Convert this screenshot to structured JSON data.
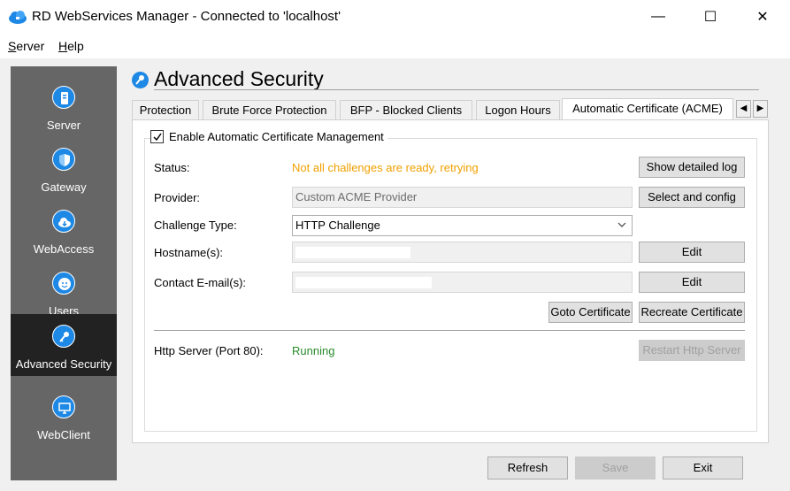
{
  "window": {
    "title": "RD WebServices Manager - Connected to 'localhost'",
    "minimize": "—",
    "maximize": "☐",
    "close": "✕"
  },
  "menu": {
    "server_first": "S",
    "server_rest": "erver",
    "help_first": "H",
    "help_rest": "elp"
  },
  "sidebar": {
    "items": [
      {
        "label": "Server",
        "icon": "server-icon",
        "active": false
      },
      {
        "label": "Gateway",
        "icon": "shield-icon",
        "active": false
      },
      {
        "label": "WebAccess",
        "icon": "cloud-icon",
        "active": false
      },
      {
        "label": "Users",
        "icon": "users-icon",
        "active": false
      },
      {
        "label": "Advanced Security",
        "icon": "key-icon",
        "active": true
      },
      {
        "label": "WebClient",
        "icon": "monitor-icon",
        "active": false
      }
    ]
  },
  "page": {
    "title": "Advanced Security"
  },
  "tabs": {
    "items": [
      {
        "label": "Protection",
        "active": false
      },
      {
        "label": "Brute Force Protection",
        "active": false
      },
      {
        "label": "BFP - Blocked Clients",
        "active": false
      },
      {
        "label": "Logon Hours",
        "active": false
      },
      {
        "label": "Automatic Certificate (ACME)",
        "active": true
      }
    ],
    "left_scroll": "◀",
    "right_scroll": "▶"
  },
  "acme": {
    "enable_label": "Enable Automatic Certificate Management",
    "enable_checked": true,
    "status_label": "Status:",
    "status_value": "Not all challenges are ready, retrying",
    "status_color": "#f0a000",
    "show_log_button": "Show detailed log",
    "provider_label": "Provider:",
    "provider_value": "Custom ACME Provider",
    "select_config_button": "Select and config",
    "challenge_label": "Challenge Type:",
    "challenge_value": "HTTP Challenge",
    "hostnames_label": "Hostname(s):",
    "hostnames_edit_button": "Edit",
    "email_label": "Contact E-mail(s):",
    "email_edit_button": "Edit",
    "goto_cert_button": "Goto Certificate",
    "recreate_cert_button": "Recreate Certificate",
    "http_server_label": "Http Server (Port 80):",
    "http_server_value": "Running",
    "http_server_color": "#2a8a2a",
    "restart_button": "Restart Http Server"
  },
  "footer": {
    "refresh": "Refresh",
    "save": "Save",
    "exit": "Exit"
  },
  "colors": {
    "accent": "#1e88e5",
    "sidebar_bg": "#666666",
    "sidebar_active_bg": "#222222"
  }
}
